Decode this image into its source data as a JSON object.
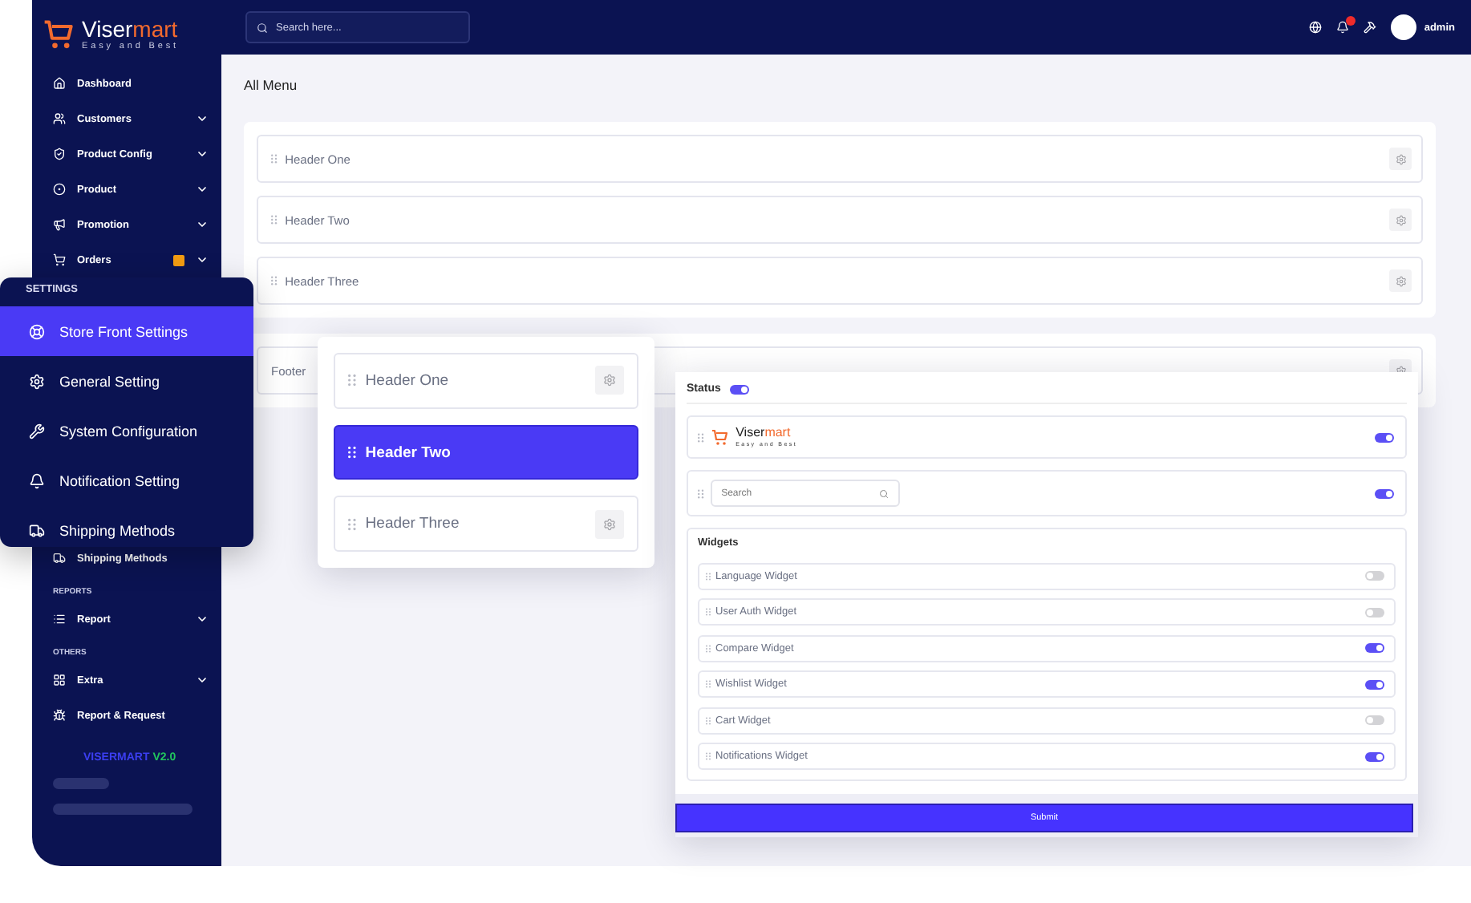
{
  "topbar": {
    "search": {
      "placeholder": "Search here..."
    },
    "notifications": {
      "unread": true
    },
    "user": {
      "name": "admin"
    }
  },
  "sidebar": {
    "brand": {
      "name_lead": "Viser",
      "name_accent": "mart",
      "tagline": "Easy and Best"
    },
    "items": [
      {
        "label": "Dashboard",
        "has_submenu": false,
        "badge": false
      },
      {
        "label": "Customers",
        "has_submenu": true,
        "badge": false
      },
      {
        "label": "Product Config",
        "has_submenu": true,
        "badge": false
      },
      {
        "label": "Product",
        "has_submenu": true,
        "badge": false
      },
      {
        "label": "Promotion",
        "has_submenu": true,
        "badge": false
      },
      {
        "label": "Orders",
        "has_submenu": true,
        "badge": true
      }
    ],
    "lower": [
      {
        "kind": "item",
        "label": "Shipping Methods",
        "has_submenu": false
      },
      {
        "kind": "heading",
        "label": "REPORTS"
      },
      {
        "kind": "item",
        "label": "Report",
        "has_submenu": true
      },
      {
        "kind": "heading",
        "label": "OTHERS"
      },
      {
        "kind": "item",
        "label": "Extra",
        "has_submenu": true
      },
      {
        "kind": "item",
        "label": "Report & Request",
        "has_submenu": false
      }
    ],
    "version": {
      "name": "VISERMART",
      "number": "V2.0"
    }
  },
  "page": {
    "title": "All Menu",
    "header_menus": [
      {
        "label": "Header One"
      },
      {
        "label": "Header Two"
      },
      {
        "label": "Header Three"
      }
    ],
    "footer_menus": [
      {
        "label": "Footer"
      }
    ]
  },
  "settings_menu": {
    "heading": "SETTINGS",
    "items": [
      {
        "label": "Store Front Settings",
        "selected": true
      },
      {
        "label": "General Setting",
        "selected": false
      },
      {
        "label": "System Configuration",
        "selected": false
      },
      {
        "label": "Notification Setting",
        "selected": false
      },
      {
        "label": "Shipping Methods",
        "selected": false
      }
    ]
  },
  "header_picker": {
    "items": [
      {
        "label": "Header One",
        "selected": false
      },
      {
        "label": "Header Two",
        "selected": true
      },
      {
        "label": "Header Three",
        "selected": false
      }
    ]
  },
  "header_editor": {
    "status": {
      "label": "Status",
      "on": true
    },
    "logo_row": {
      "name_lead": "Viser",
      "name_accent": "mart",
      "tagline": "Easy and Best",
      "on": true
    },
    "search_row": {
      "placeholder": "Search",
      "on": true
    },
    "widgets": {
      "title": "Widgets",
      "items": [
        {
          "label": "Language Widget",
          "on": false
        },
        {
          "label": "User Auth Widget",
          "on": false
        },
        {
          "label": "Compare Widget",
          "on": true
        },
        {
          "label": "Wishlist Widget",
          "on": true
        },
        {
          "label": "Cart Widget",
          "on": false
        },
        {
          "label": "Notifications Widget",
          "on": true
        }
      ]
    },
    "submit": "Submit"
  }
}
